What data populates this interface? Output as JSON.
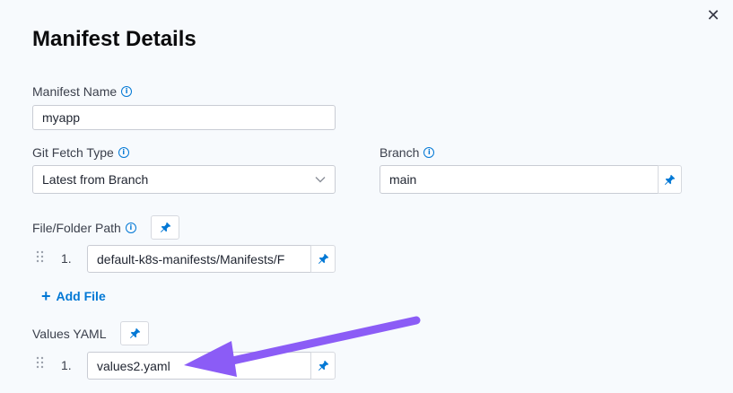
{
  "dialog": {
    "title": "Manifest Details",
    "close_glyph": "✕"
  },
  "manifest_name": {
    "label": "Manifest Name",
    "value": "myapp"
  },
  "git_fetch_type": {
    "label": "Git Fetch Type",
    "value": "Latest from Branch"
  },
  "branch": {
    "label": "Branch",
    "value": "main"
  },
  "file_folder_path": {
    "label": "File/Folder Path",
    "items": [
      {
        "index": "1.",
        "value": "default-k8s-manifests/Manifests/F"
      }
    ],
    "add_label": "Add File"
  },
  "values_yaml": {
    "label": "Values YAML",
    "items": [
      {
        "index": "1.",
        "value": "values2.yaml"
      }
    ]
  },
  "annotation": {
    "color": "#8b5cf6"
  },
  "colors": {
    "accent": "#0278d5",
    "background": "#f7fafd"
  },
  "icons": [
    "close-icon",
    "info-icon",
    "pin-icon",
    "chevron-down-icon",
    "drag-handle-icon",
    "plus-icon"
  ]
}
